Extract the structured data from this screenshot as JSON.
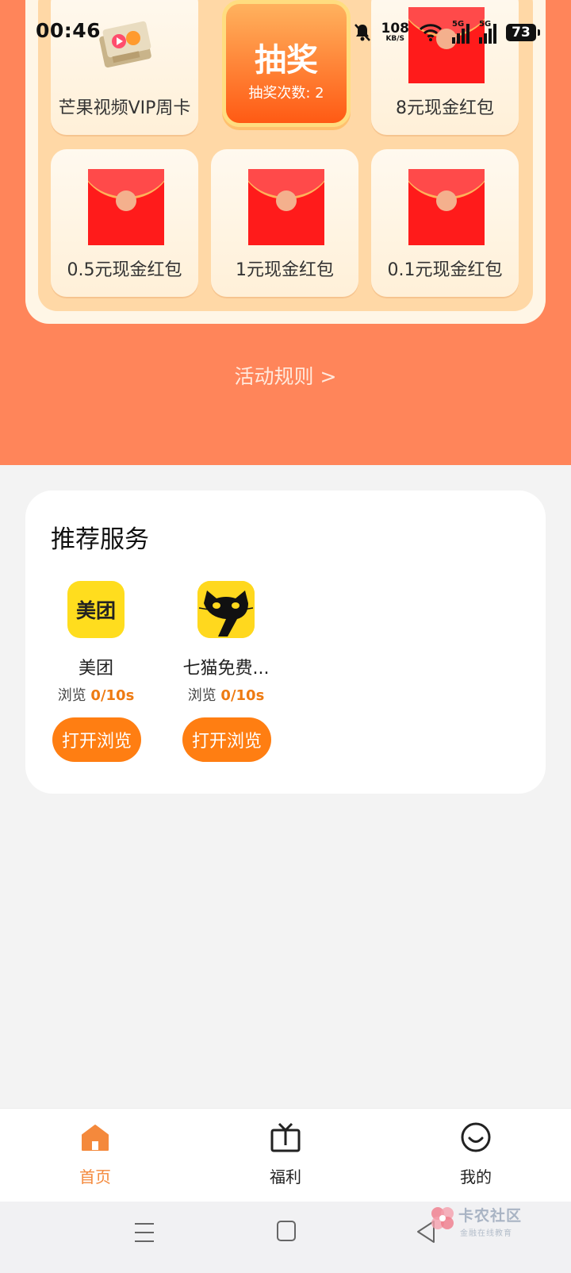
{
  "status_bar": {
    "time": "00:46",
    "net_speed": "108",
    "net_unit": "KB/S",
    "sim1": "5G",
    "sim2": "5G",
    "battery": "73"
  },
  "lottery": {
    "prizes": [
      {
        "label": "芒果视频VIP周卡",
        "icon": "mango-video-vip-card"
      },
      {
        "label": "8元现金红包",
        "icon": "red-envelope"
      },
      {
        "label": "0.5元现金红包",
        "icon": "red-envelope"
      },
      {
        "label": "1元现金红包",
        "icon": "red-envelope"
      },
      {
        "label": "0.1元现金红包",
        "icon": "red-envelope"
      }
    ],
    "draw_button": {
      "title": "抽奖",
      "count_text": "抽奖次数: 2"
    },
    "rules_link": "活动规则 >"
  },
  "services": {
    "title": "推荐服务",
    "items": [
      {
        "name": "美团",
        "icon_text": "美团",
        "progress_label": "浏览",
        "progress_value": "0/10s",
        "button": "打开浏览"
      },
      {
        "name": "七猫免费...",
        "icon": "cat-seven-icon",
        "progress_label": "浏览",
        "progress_value": "0/10s",
        "button": "打开浏览"
      }
    ]
  },
  "tabbar": {
    "tabs": [
      {
        "label": "首页",
        "icon": "home-icon",
        "active": true
      },
      {
        "label": "福利",
        "icon": "tv-icon",
        "active": false
      },
      {
        "label": "我的",
        "icon": "smile-icon",
        "active": false
      }
    ]
  },
  "watermark": {
    "main": "卡农社区",
    "sub": "金融在线教育"
  },
  "colors": {
    "top_background": "#ff855a",
    "accent": "#ff7e12",
    "active_tab": "#f4893c",
    "red_envelope": "#ff1b1b"
  }
}
